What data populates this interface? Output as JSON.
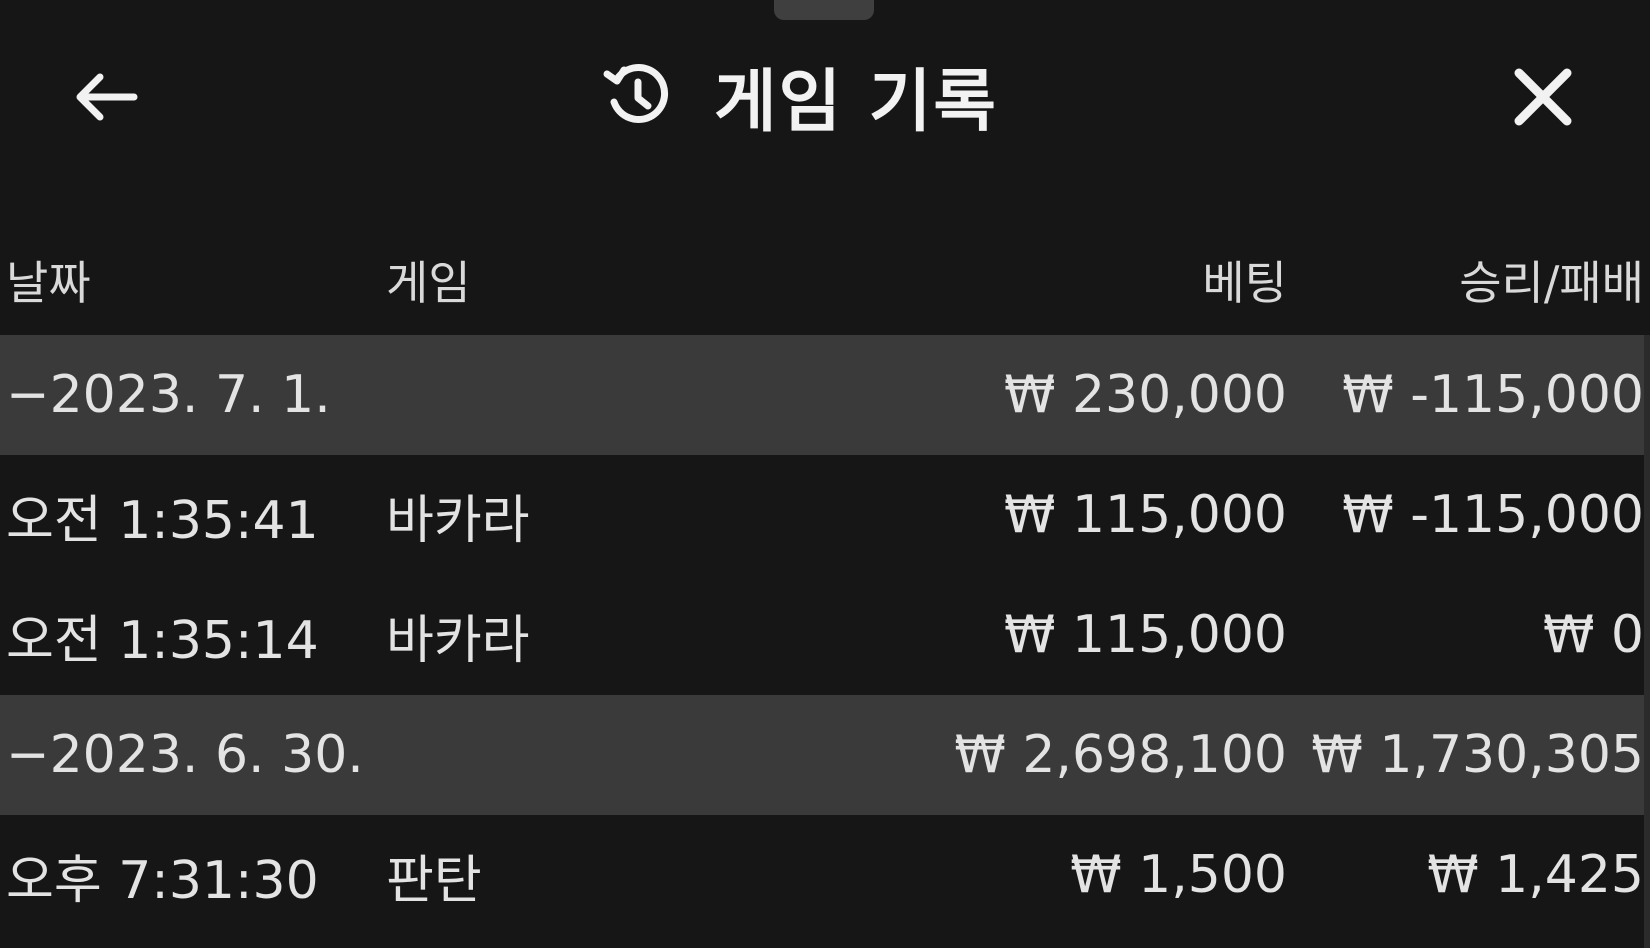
{
  "header": {
    "title": "게임 기록",
    "back_icon": "arrow-left-icon",
    "history_icon": "history-clock-icon",
    "close_icon": "close-icon"
  },
  "table": {
    "columns": [
      "날짜",
      "게임",
      "베팅",
      "승리/패배"
    ],
    "groups": [
      {
        "date": "−2023. 7. 1.",
        "bet": "₩ 230,000",
        "result": "₩ -115,000",
        "rows": [
          {
            "time": "오전 1:35:41",
            "game": "바카라",
            "bet": "₩ 115,000",
            "result": "₩ -115,000"
          },
          {
            "time": "오전 1:35:14",
            "game": "바카라",
            "bet": "₩ 115,000",
            "result": "₩ 0"
          }
        ]
      },
      {
        "date": "−2023. 6. 30.",
        "bet": "₩ 2,698,100",
        "result": "₩ 1,730,305",
        "rows": [
          {
            "time": "오후 7:31:30",
            "game": "판탄",
            "bet": "₩ 1,500",
            "result": "₩ 1,425"
          }
        ]
      }
    ]
  },
  "colors": {
    "background": "#161616",
    "group_row": "#3a3a3a",
    "text": "#e3e3e3"
  }
}
